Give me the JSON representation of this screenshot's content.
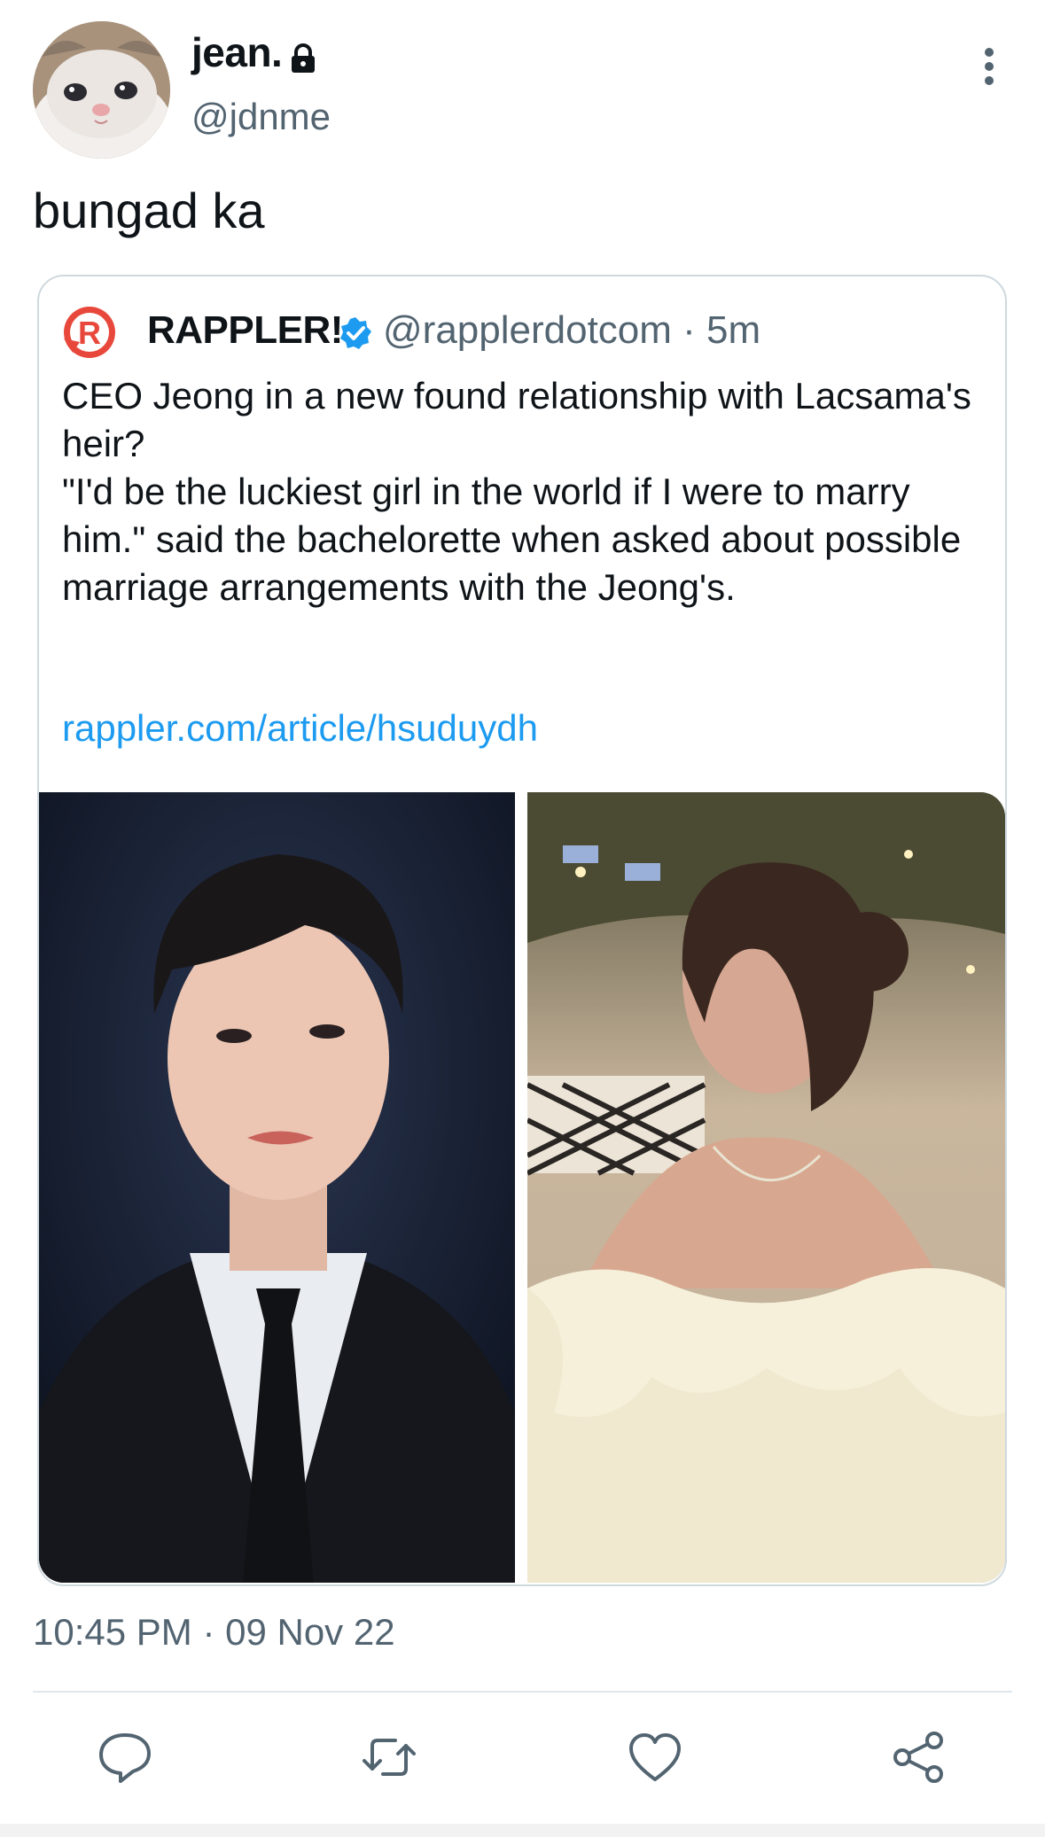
{
  "tweet": {
    "display_name": "jean.",
    "handle": "@jdnme",
    "text": "bungad ka",
    "timestamp": "10:45 PM · 09 Nov 22",
    "avatar_icon": "cat-avatar",
    "protected_icon": "lock-icon",
    "menu_icon": "more-vertical-icon"
  },
  "quoted_tweet": {
    "logo_icon": "rappler-logo",
    "display_name": "RAPPLER!",
    "verified_icon": "verified-badge-icon",
    "handle_and_time": "@rapplerdotcom · 5m",
    "body_lines": [
      "CEO Jeong in a new found relationship with Lacsama's heir?",
      "\"I'd be the luckiest girl in the world if I were to marry him.\" said the bachelorette when asked about possible marriage arrangements with the Jeong's."
    ],
    "link": "rappler.com/article/hsuduydh",
    "media": [
      {
        "icon": "photo-man-in-suit"
      },
      {
        "icon": "photo-woman-in-dress"
      }
    ]
  },
  "actions": [
    {
      "name": "reply",
      "icon": "reply-icon"
    },
    {
      "name": "retweet",
      "icon": "retweet-icon"
    },
    {
      "name": "like",
      "icon": "heart-icon"
    },
    {
      "name": "share",
      "icon": "share-icon"
    }
  ],
  "colors": {
    "text": "#0f1419",
    "secondary": "#536471",
    "link": "#1d9bf0",
    "border": "#cfd9de",
    "verified": "#1d9bf0",
    "brand": "#e8483b"
  }
}
